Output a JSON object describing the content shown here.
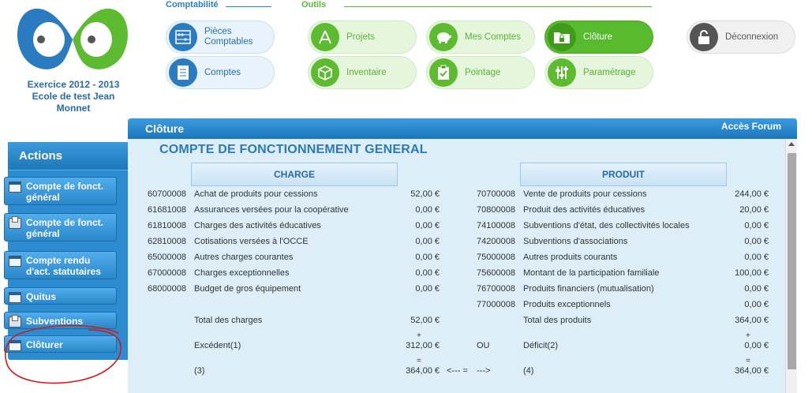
{
  "exercise": {
    "line1": "Exercice 2012 - 2013",
    "line2": "Ecole de test Jean",
    "line3": "Monnet"
  },
  "sections": {
    "comptabilite": "Comptabilité",
    "outils": "Outils"
  },
  "nav": {
    "pieces": "Pièces Comptables",
    "comptes": "Comptes",
    "projets": "Projets",
    "inventaire": "Inventaire",
    "mes_comptes": "Mes Comptes",
    "pointage": "Pointage",
    "cloture": "Clôture",
    "parametrage": "Paramétrage",
    "deconnexion": "Déconnexion"
  },
  "sidebar": {
    "title": "Actions",
    "items": [
      {
        "label": "Compte de fonct. général",
        "icon": "calendar-icon"
      },
      {
        "label": "Compte de fonct. général",
        "icon": "printer-icon"
      },
      {
        "label": "Compte rendu d'act. statutaires",
        "icon": "calendar-icon"
      },
      {
        "label": "Quitus",
        "icon": "calendar-icon"
      },
      {
        "label": "Subventions",
        "icon": "printer-icon"
      },
      {
        "label": "Clôturer",
        "icon": "calendar-icon"
      }
    ]
  },
  "main": {
    "header": "Clôture",
    "forum": "Accès Forum",
    "title": "COMPTE DE FONCTIONNEMENT GENERAL",
    "charge_header": "CHARGE",
    "produit_header": "PRODUIT"
  },
  "rows": [
    {
      "code": "60700008",
      "label": "Achat de produits pour cessions",
      "amount": "52,00 €",
      "code2": "70700008",
      "label2": "Vente de produits pour cessions",
      "amount2": "244,00 €"
    },
    {
      "code": "61681008",
      "label": "Assurances versées pour la coopérative",
      "amount": "0,00 €",
      "code2": "70800008",
      "label2": "Produit des activités éducatives",
      "amount2": "20,00 €"
    },
    {
      "code": "61810008",
      "label": "Charges des activités éducatives",
      "amount": "0,00 €",
      "code2": "74100008",
      "label2": "Subventions d'état, des collectivités locales",
      "amount2": "0,00 €"
    },
    {
      "code": "62810008",
      "label": "Cotisations versées à l'OCCE",
      "amount": "0,00 €",
      "code2": "74200008",
      "label2": "Subventions d'associations",
      "amount2": "0,00 €"
    },
    {
      "code": "65000008",
      "label": "Autres charges courantes",
      "amount": "0,00 €",
      "code2": "75000008",
      "label2": "Autres produits courants",
      "amount2": "0,00 €"
    },
    {
      "code": "67000008",
      "label": "Charges exceptionnelles",
      "amount": "0,00 €",
      "code2": "75600008",
      "label2": "Montant de la participation familiale",
      "amount2": "100,00 €"
    },
    {
      "code": "68000008",
      "label": "Budget de gros équipement",
      "amount": "0,00 €",
      "code2": "76700008",
      "label2": "Produits financiers (mutualisation)",
      "amount2": "0,00 €"
    },
    {
      "code": "",
      "label": "",
      "amount": "",
      "code2": "77000008",
      "label2": "Produits exceptionnels",
      "amount2": "0,00 €"
    }
  ],
  "totals": {
    "charges_label": "Total des charges",
    "charges_amount": "52,00 €",
    "produits_label": "Total des produits",
    "produits_amount": "364,00 €",
    "plus": "+",
    "excedent_label": "Excédent(1)",
    "excedent_amount": "312,00 €",
    "ou": "OU",
    "deficit_label": "Déficit(2)",
    "deficit_amount": "0,00 €",
    "equals": "=",
    "ref3": "(3)",
    "final_left": "364,00 €",
    "arrow_left": "<--- =",
    "arrow_right": "--->",
    "ref4": "(4)",
    "final_right": "364,00 €"
  },
  "colors": {
    "blue": "#2a7bbf",
    "green": "#5cbb2f",
    "panel": "#ddeef9",
    "annotation": "#d11a1a"
  }
}
